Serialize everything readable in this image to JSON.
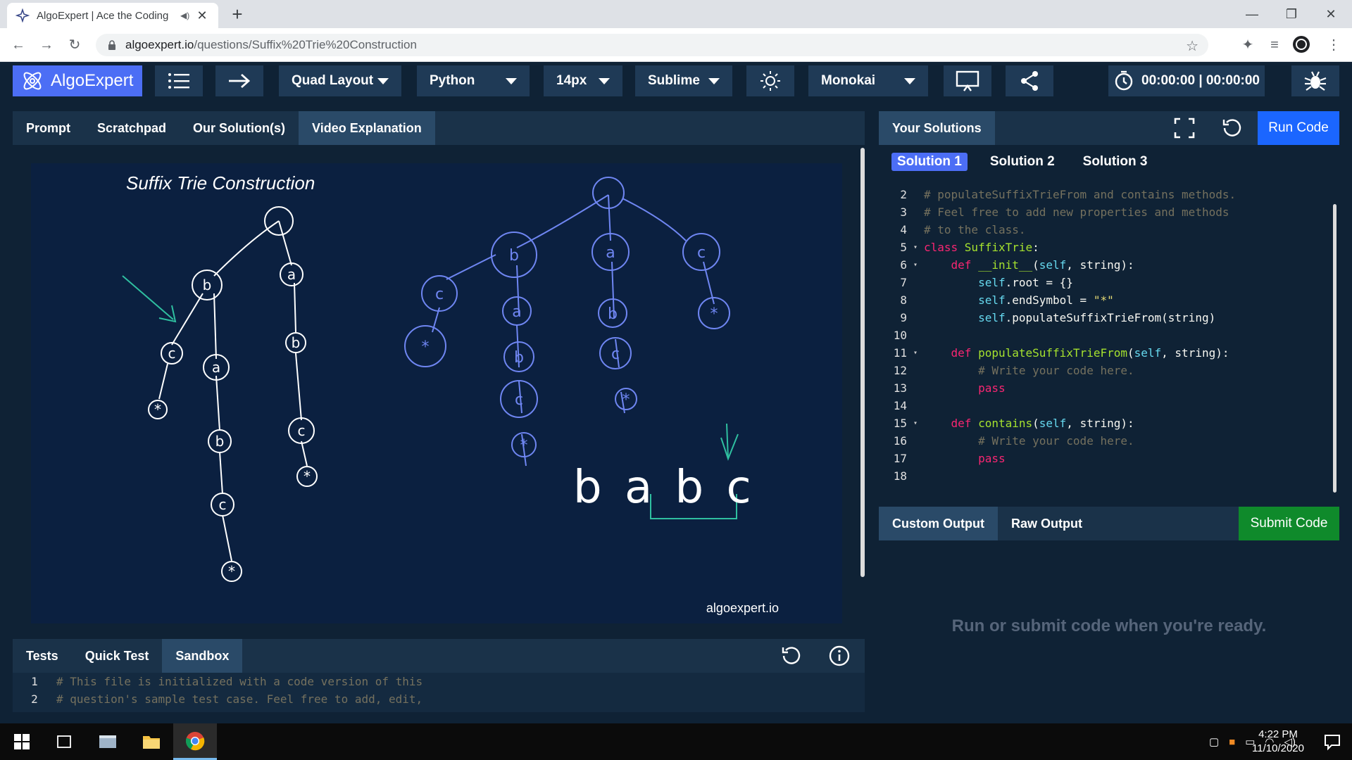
{
  "browser": {
    "tab_title": "AlgoExpert | Ace the Coding",
    "url_domain": "algoexpert.io",
    "url_path": "/questions/Suffix%20Trie%20Construction"
  },
  "toolbar": {
    "brand": "AlgoExpert",
    "layout_label": "Quad Layout",
    "language_label": "Python",
    "font_size_label": "14px",
    "keymap_label": "Sublime",
    "theme_label": "Monokai",
    "timer_label": "00:00:00 | 00:00:00"
  },
  "left_panel": {
    "tabs": [
      "Prompt",
      "Scratchpad",
      "Our Solution(s)",
      "Video Explanation"
    ],
    "active_tab": 3,
    "video": {
      "heading": "Suffix Trie Construction",
      "watermark": "algoexpert.io",
      "trie1_labels": [
        "b",
        "a",
        "c",
        "a",
        "b",
        "b",
        "c",
        "c"
      ],
      "trie2_labels": [
        "b",
        "a",
        "c",
        "c",
        "a",
        "b",
        "b",
        "c",
        "c"
      ],
      "word": "b a b c"
    }
  },
  "bottom_left": {
    "tabs": [
      "Tests",
      "Quick Test",
      "Sandbox"
    ],
    "active_tab": 2,
    "lines": [
      {
        "n": "1",
        "text": "# This file is initialized with a code version of this"
      },
      {
        "n": "2",
        "text": "# question's sample test case. Feel free to add, edit,"
      }
    ]
  },
  "right_panel": {
    "title": "Your Solutions",
    "run_label": "Run Code",
    "solution_tabs": [
      "Solution 1",
      "Solution 2",
      "Solution 3"
    ],
    "code_lines": [
      {
        "n": "2",
        "fold": "",
        "indent": "",
        "parts": [
          {
            "t": "# populateSuffixTrieFrom and contains methods.",
            "c": "cm"
          }
        ]
      },
      {
        "n": "3",
        "fold": "",
        "indent": "",
        "parts": [
          {
            "t": "# Feel free to add new properties and methods",
            "c": "cm"
          }
        ]
      },
      {
        "n": "4",
        "fold": "",
        "indent": "",
        "parts": [
          {
            "t": "# to the class.",
            "c": "cm"
          }
        ]
      },
      {
        "n": "5",
        "fold": "▾",
        "indent": "",
        "parts": [
          {
            "t": "class ",
            "c": "kw"
          },
          {
            "t": "SuffixTrie",
            "c": "cls"
          },
          {
            "t": ":",
            "c": "pl"
          }
        ]
      },
      {
        "n": "6",
        "fold": "▾",
        "indent": "    ",
        "parts": [
          {
            "t": "def ",
            "c": "kw"
          },
          {
            "t": "__init__",
            "c": "fn"
          },
          {
            "t": "(",
            "c": "pl"
          },
          {
            "t": "self",
            "c": "self"
          },
          {
            "t": ", string):",
            "c": "pl"
          }
        ]
      },
      {
        "n": "7",
        "fold": "",
        "indent": "        ",
        "parts": [
          {
            "t": "self",
            "c": "self"
          },
          {
            "t": ".root = {}",
            "c": "pl"
          }
        ]
      },
      {
        "n": "8",
        "fold": "",
        "indent": "        ",
        "parts": [
          {
            "t": "self",
            "c": "self"
          },
          {
            "t": ".endSymbol = ",
            "c": "pl"
          },
          {
            "t": "\"*\"",
            "c": "str"
          }
        ]
      },
      {
        "n": "9",
        "fold": "",
        "indent": "        ",
        "parts": [
          {
            "t": "self",
            "c": "self"
          },
          {
            "t": ".populateSuffixTrieFrom(string)",
            "c": "pl"
          }
        ]
      },
      {
        "n": "10",
        "fold": "",
        "indent": "",
        "parts": []
      },
      {
        "n": "11",
        "fold": "▾",
        "indent": "    ",
        "parts": [
          {
            "t": "def ",
            "c": "kw"
          },
          {
            "t": "populateSuffixTrieFrom",
            "c": "fn"
          },
          {
            "t": "(",
            "c": "pl"
          },
          {
            "t": "self",
            "c": "self"
          },
          {
            "t": ", string):",
            "c": "pl"
          }
        ]
      },
      {
        "n": "12",
        "fold": "",
        "indent": "        ",
        "parts": [
          {
            "t": "# Write your code here.",
            "c": "cm"
          }
        ]
      },
      {
        "n": "13",
        "fold": "",
        "indent": "        ",
        "parts": [
          {
            "t": "pass",
            "c": "kw"
          }
        ]
      },
      {
        "n": "14",
        "fold": "",
        "indent": "",
        "parts": []
      },
      {
        "n": "15",
        "fold": "▾",
        "indent": "    ",
        "parts": [
          {
            "t": "def ",
            "c": "kw"
          },
          {
            "t": "contains",
            "c": "fn"
          },
          {
            "t": "(",
            "c": "pl"
          },
          {
            "t": "self",
            "c": "self"
          },
          {
            "t": ", string):",
            "c": "pl"
          }
        ]
      },
      {
        "n": "16",
        "fold": "",
        "indent": "        ",
        "parts": [
          {
            "t": "# Write your code here.",
            "c": "cm"
          }
        ]
      },
      {
        "n": "17",
        "fold": "",
        "indent": "        ",
        "parts": [
          {
            "t": "pass",
            "c": "kw"
          }
        ]
      },
      {
        "n": "18",
        "fold": "",
        "indent": "",
        "parts": []
      }
    ],
    "syntax_colors": {
      "cm": "#75715e",
      "kw": "#f92672",
      "cls": "#a6e22e",
      "fn": "#a6e22e",
      "self": "#66d9ef",
      "str": "#e6db74",
      "pl": "#f8f8f2"
    }
  },
  "output_panel": {
    "tabs": [
      "Custom Output",
      "Raw Output"
    ],
    "submit_label": "Submit Code",
    "placeholder": "Run or submit code when you're ready."
  },
  "taskbar": {
    "time": "4:22 PM",
    "date": "11/10/2020"
  },
  "colors": {
    "brand_blue": "#4c6ef5",
    "run_blue": "#1b66ff",
    "submit_green": "#0f8a2b",
    "app_bg": "#0f2235"
  }
}
